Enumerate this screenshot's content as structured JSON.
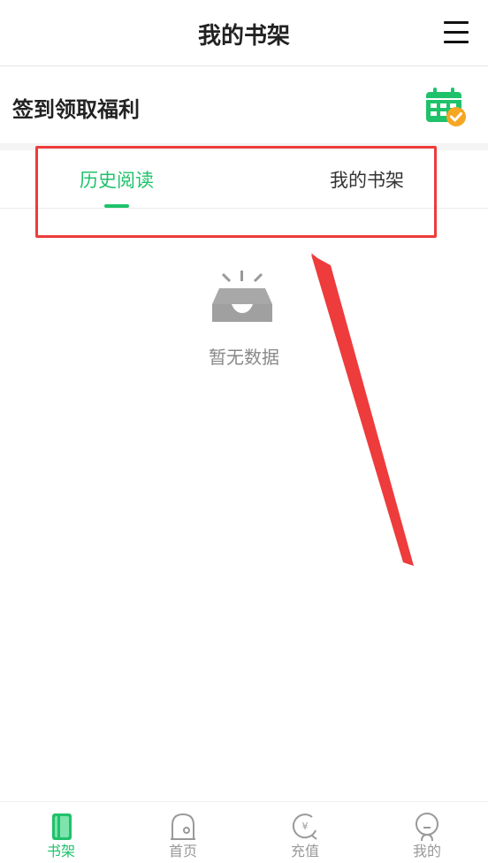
{
  "header": {
    "title": "我的书架",
    "menu_icon": "hamburger-menu-icon"
  },
  "checkin": {
    "label": "签到领取福利",
    "icon": "calendar-check-icon"
  },
  "tabs": [
    {
      "label": "历史阅读",
      "active": true
    },
    {
      "label": "我的书架",
      "active": false
    }
  ],
  "empty_state": {
    "text": "暂无数据",
    "icon": "empty-tray-icon"
  },
  "bottom_nav": [
    {
      "label": "书架",
      "icon": "bookshelf-icon",
      "active": true
    },
    {
      "label": "首页",
      "icon": "home-icon",
      "active": false
    },
    {
      "label": "充值",
      "icon": "recharge-yen-icon",
      "active": false
    },
    {
      "label": "我的",
      "icon": "profile-icon",
      "active": false
    }
  ],
  "colors": {
    "accent": "#1fc26b",
    "highlight_box": "#ee3b3b",
    "badge": "#f5a623"
  }
}
